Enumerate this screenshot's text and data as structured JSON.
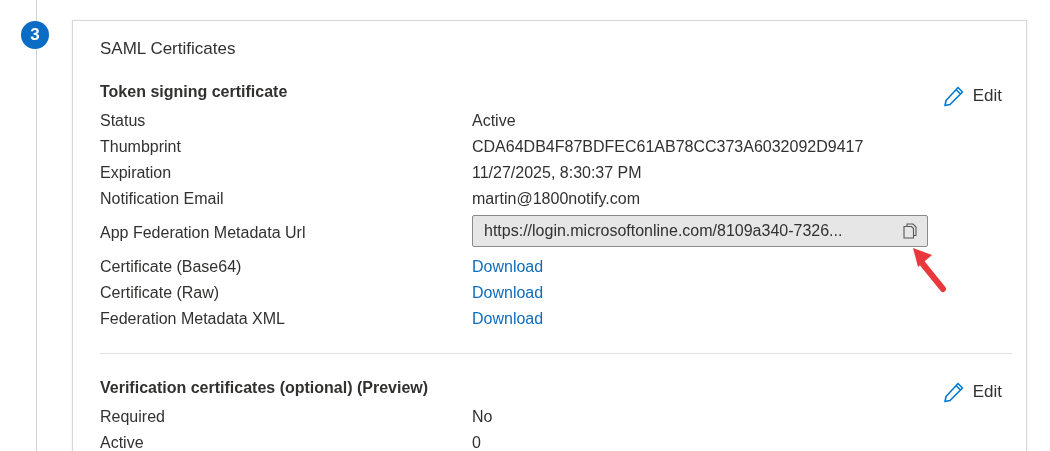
{
  "step": {
    "number": "3"
  },
  "card": {
    "title": "SAML Certificates",
    "sections": [
      {
        "heading": "Token signing certificate",
        "edit": "Edit",
        "rows": [
          {
            "label": "Status",
            "kind": "text",
            "value": "Active"
          },
          {
            "label": "Thumbprint",
            "kind": "text",
            "value": "CDA64DB4F87BDFEC61AB78CC373A6032092D9417"
          },
          {
            "label": "Expiration",
            "kind": "text",
            "value": "11/27/2025, 8:30:37 PM"
          },
          {
            "label": "Notification Email",
            "kind": "text",
            "value": "martin@1800notify.com"
          },
          {
            "label": "App Federation Metadata Url",
            "kind": "copy-field",
            "value": "https://login.microsoftonline.com/8109a340-7326..."
          },
          {
            "label": "Certificate (Base64)",
            "kind": "link",
            "value": "Download"
          },
          {
            "label": "Certificate (Raw)",
            "kind": "link",
            "value": "Download"
          },
          {
            "label": "Federation Metadata XML",
            "kind": "link",
            "value": "Download"
          }
        ]
      },
      {
        "heading": "Verification certificates (optional) (Preview)",
        "edit": "Edit",
        "rows": [
          {
            "label": "Required",
            "kind": "text",
            "value": "No"
          },
          {
            "label": "Active",
            "kind": "text",
            "value": "0"
          }
        ]
      }
    ]
  }
}
